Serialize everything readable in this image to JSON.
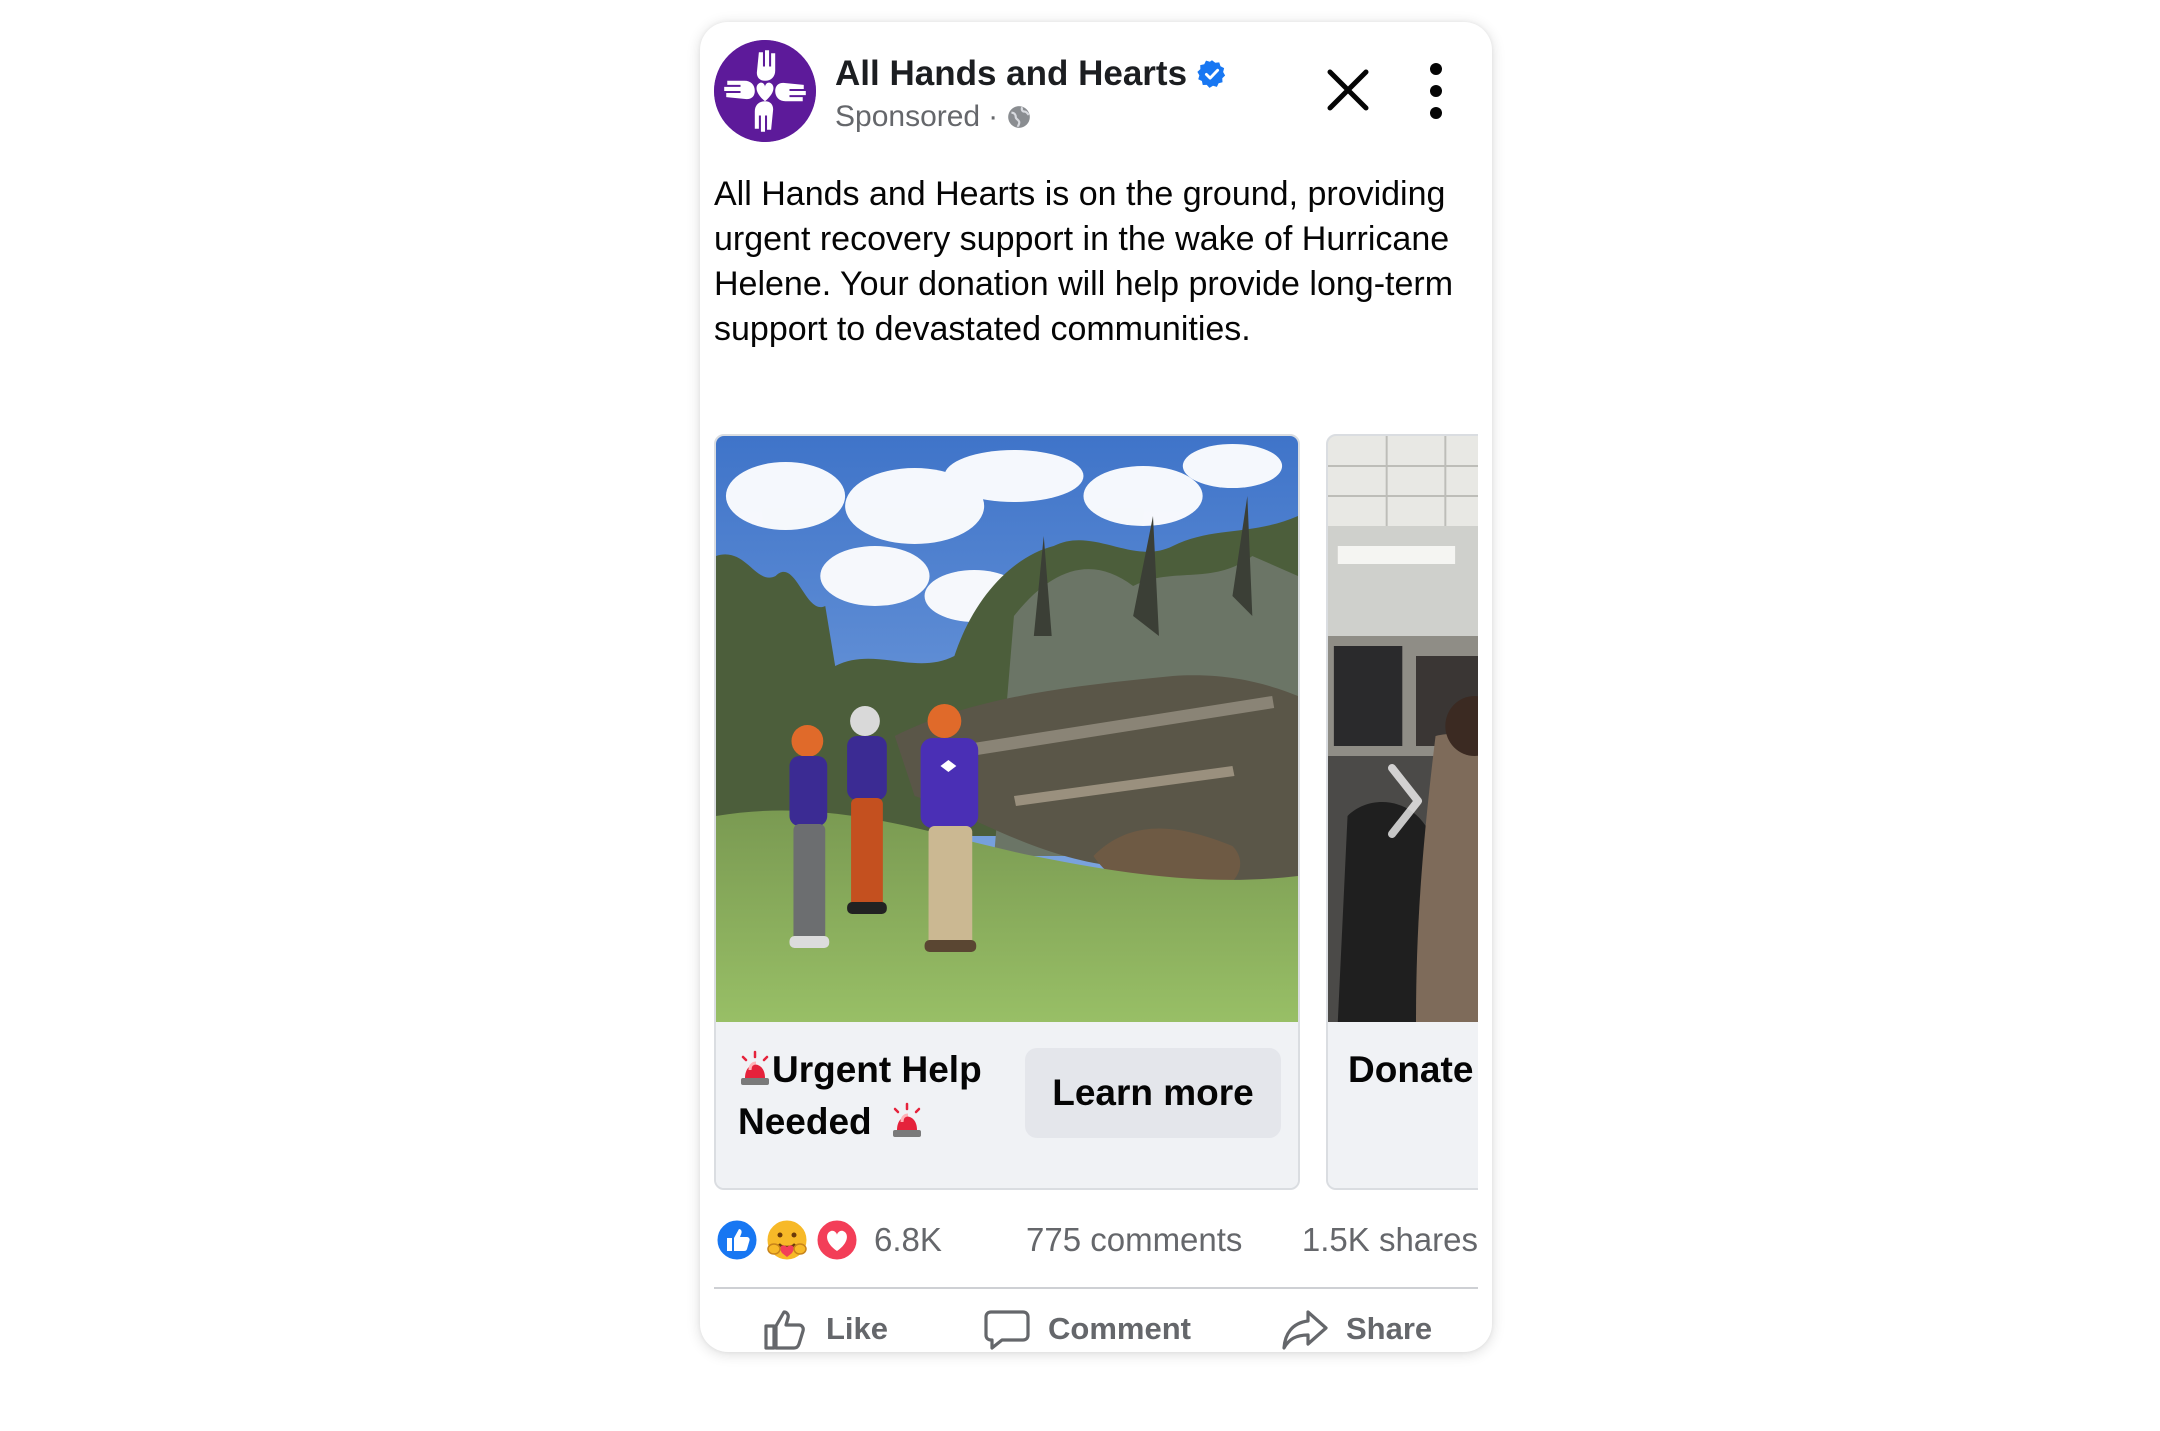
{
  "post": {
    "page_name": "All Hands and Hearts",
    "sponsored_label": "Sponsored",
    "separator": "·",
    "body": "All Hands and Hearts is on the ground, providing urgent recovery support in the wake of Hurricane Helene. Your donation will help provide long-term support to devastated communities."
  },
  "carousel": {
    "cards": [
      {
        "headline_line1": "Urgent Help",
        "headline_line2": "Needed",
        "cta_label": "Learn more"
      },
      {
        "headline": "Donate"
      }
    ]
  },
  "stats": {
    "reactions_count": "6.8K",
    "comments": "775 comments",
    "shares": "1.5K shares"
  },
  "actions": {
    "like": "Like",
    "comment": "Comment",
    "share": "Share"
  },
  "colors": {
    "brand_purple": "#5d1a9a",
    "verified_blue": "#1877f2",
    "like_blue": "#1877f2",
    "love_red": "#f33e58",
    "care_yellow": "#f7b928",
    "muted_text": "#65676b"
  },
  "icons": {
    "avatar": "hands-and-hearts-logo",
    "verified": "verified-badge-icon",
    "audience": "globe-icon",
    "close": "close-icon",
    "more": "more-vertical-icon",
    "siren": "police-siren-emoji",
    "reactions": [
      "like-reaction-icon",
      "care-reaction-icon",
      "love-reaction-icon"
    ],
    "like": "thumbs-up-icon",
    "comment": "comment-bubble-icon",
    "share": "share-arrow-icon",
    "carousel_next": "chevron-right-icon"
  }
}
